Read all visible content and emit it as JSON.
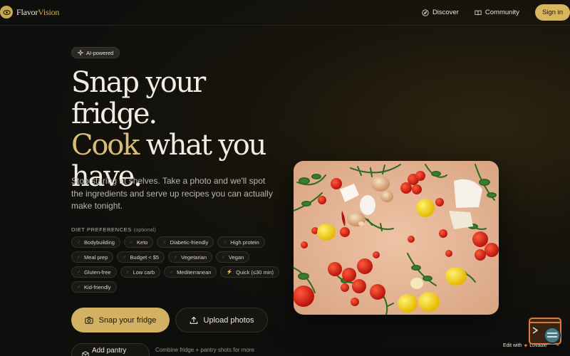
{
  "nav": {
    "brand_prefix": "Flavor",
    "brand_suffix": "Vision",
    "discover": "Discover",
    "community": "Community",
    "sign_in": "Sign in"
  },
  "hero": {
    "badge": "AI-powered",
    "headline_line1": "Snap your fridge.",
    "headline_gold": "Cook",
    "headline_rest": "what you have.",
    "subtitle": "Stop staring at shelves. Take a photo and we'll spot the ingredients and serve up recipes you can actually make tonight."
  },
  "diet": {
    "label": "DIET PREFERENCES",
    "optional": "(optional)",
    "options": [
      "Bodybuilding",
      "Keto",
      "Diabetic-friendly",
      "High protein",
      "Meal prep",
      "Budget < $5",
      "Vegetarian",
      "Vegan",
      "Gluten-free",
      "Low carb",
      "Mediterranean",
      "Quick (≤30 min)",
      "Kid-friendly"
    ]
  },
  "actions": {
    "snap": "Snap your fridge",
    "upload": "Upload photos",
    "pantry": "Add pantry",
    "pantry_note": "Combine fridge + pantry shots for more"
  },
  "badge": {
    "edit_with": "Edit with",
    "brand": "Lovable",
    "close": "×"
  },
  "colors": {
    "accent": "#d2b262",
    "background": "#0e0e0d",
    "headline_gold": "#d8bd78"
  }
}
